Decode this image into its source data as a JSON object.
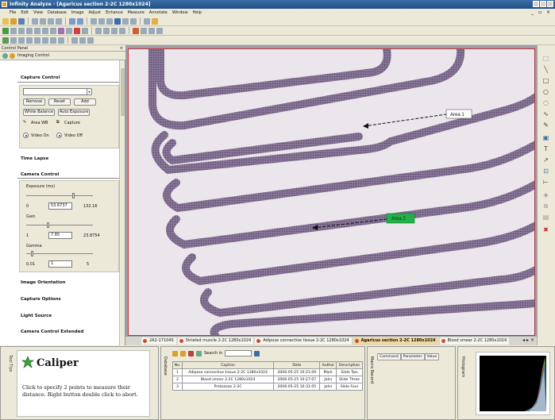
{
  "window": {
    "title": "Infinity Analyze - [Agaricus section 2-2C 1280x1024]"
  },
  "menu": [
    "File",
    "Edit",
    "View",
    "Database",
    "Image",
    "Adjust",
    "Enhance",
    "Measure",
    "Annotate",
    "Window",
    "Help"
  ],
  "control_panel": {
    "header": "Control Panel",
    "tab": "Imaging Control",
    "capture": {
      "title": "Capture Control",
      "remove": "Remove",
      "reset": "Reset",
      "add": "Add",
      "white_balance": "White Balance",
      "auto_exposure": "Auto Exposure",
      "area_wb": "Area WB",
      "capture": "Capture",
      "video_on": "Video On",
      "video_off": "Video Off"
    },
    "time_lapse": "Time Lapse",
    "camera": {
      "title": "Camera Control",
      "exposure_label": "Exposure (ms)",
      "exposure_min": "0",
      "exposure_value": "53.6737",
      "exposure_max": "132.16",
      "gain_label": "Gain",
      "gain_min": "1",
      "gain_value": "7.85",
      "gain_max": "23.8754",
      "gamma_label": "Gamma",
      "gamma_min": "0.01",
      "gamma_value": "1",
      "gamma_max": "5"
    },
    "sections": [
      "Image Orientation",
      "Capture Options",
      "Light Source",
      "Camera Control Extended"
    ]
  },
  "image": {
    "annotations": [
      {
        "label": "Area 1",
        "color": "#ffffff"
      },
      {
        "label": "Area 2",
        "color": "#22b04a"
      }
    ]
  },
  "image_tabs": [
    "2A2-17104S",
    "Striated muscle 2-2C 1280x1024",
    "Adipose connective tissue 2-2C 1280x1024",
    "Agaricus section 2-2C 1280x1024",
    "Blood smear 2-2C 1280x1024"
  ],
  "caliper": {
    "side_label": "Tool Tips",
    "title": "Caliper",
    "description": "Click to specify 2 points to measure their distance. Right button double click to abort."
  },
  "database": {
    "side_label": "Database",
    "search_label": "Search in",
    "columns": [
      "No.",
      "Caption",
      "Date",
      "Author",
      "Description"
    ],
    "rows": [
      [
        "1",
        "Adipose connective tissue 2-2C 1280x1024",
        "2006-05-25 10:21:09",
        "Mark",
        "Slide Two"
      ],
      [
        "2",
        "Blood smear 2-2C 1280x1024",
        "2006-05-25 10:27:07",
        "John",
        "Slide Three"
      ],
      [
        "3",
        "Protozoan 2-2C",
        "2006-05-25 10:31:05",
        "John",
        "Slide Four"
      ]
    ]
  },
  "macro": {
    "side_label": "Macro Record",
    "columns": [
      "Command",
      "Parameter",
      "Value"
    ]
  },
  "histogram": {
    "side_label": "Histogram"
  },
  "colors": {
    "accent": "#204f86",
    "area2": "#22b04a",
    "tab_active": "#f0d8a0"
  }
}
